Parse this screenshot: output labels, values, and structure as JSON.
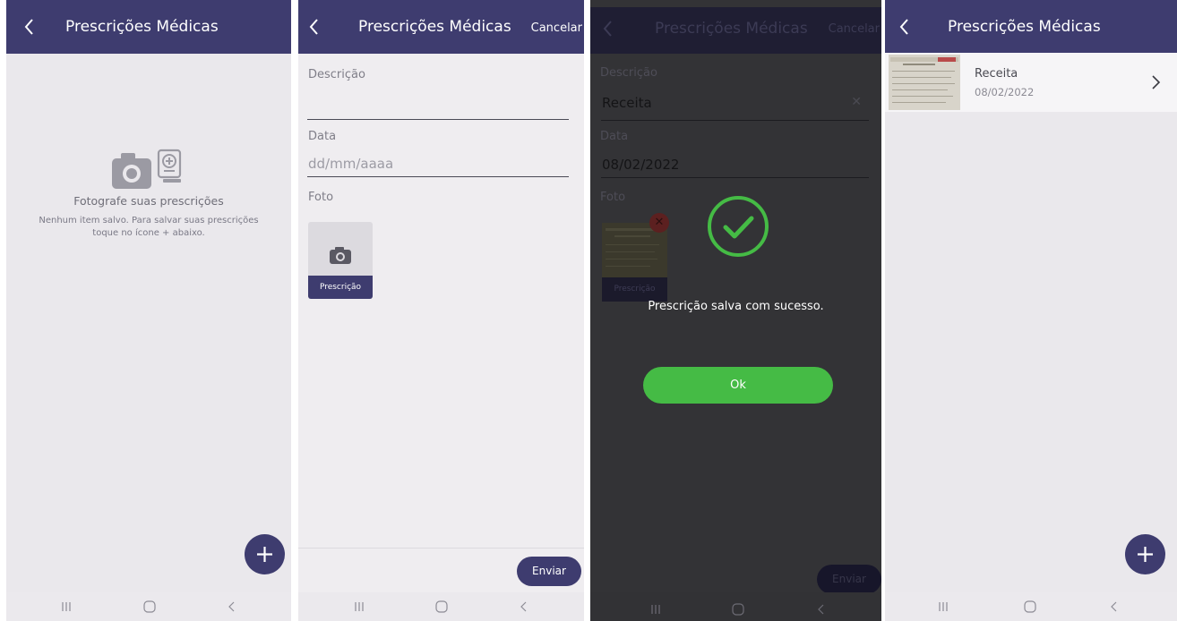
{
  "screens": {
    "empty": {
      "title": "Prescrições Médicas",
      "empty_title": "Fotografe suas prescrições",
      "empty_message": "Nenhum item salvo. Para salvar suas prescrições toque no ícone + abaixo.",
      "icons": [
        "back-chevron-icon",
        "camera-icon",
        "prescription-document-icon",
        "plus-icon"
      ]
    },
    "form": {
      "title": "Prescrições Médicas",
      "cancel_label": "Cancelar",
      "description_label": "Descrição",
      "description_value": "",
      "date_label": "Data",
      "date_placeholder": "dd/mm/aaaa",
      "photo_label": "Foto",
      "photo_tile_label": "Prescrição",
      "send_label": "Enviar"
    },
    "success": {
      "title": "Prescrições Médicas",
      "cancel_label": "Cancelar",
      "description_label": "Descrição",
      "description_value": "Receita",
      "date_label": "Data",
      "date_value": "08/02/2022",
      "photo_label": "Foto",
      "photo_tile_label": "Prescrição",
      "send_label": "Enviar",
      "message": "Prescrição salva com sucesso.",
      "ok_label": "Ok"
    },
    "list": {
      "title": "Prescrições Médicas",
      "items": [
        {
          "title": "Receita",
          "date": "08/02/2022"
        }
      ]
    }
  },
  "colors": {
    "header": "#3e3c6f",
    "background": "#eae8ec",
    "success": "#45bb45",
    "overlay": "#333336"
  }
}
